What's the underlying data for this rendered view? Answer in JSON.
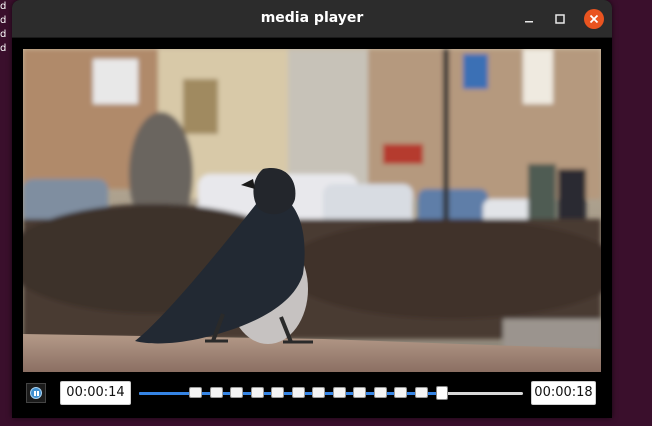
{
  "desktop": {
    "side_letters": [
      "d",
      "d",
      "d",
      "d"
    ]
  },
  "window": {
    "title": "media player",
    "buttons": {
      "minimize_icon": "minimize-icon",
      "maximize_icon": "maximize-icon",
      "close_icon": "close-icon"
    }
  },
  "video": {
    "scene": "frame"
  },
  "controls": {
    "play_pause_icon": "pause-icon",
    "current_time": "00:00:14",
    "total_time": "00:00:18",
    "progress_fraction": 0.79,
    "accent_color": "#3584e4",
    "close_color": "#e95420"
  }
}
